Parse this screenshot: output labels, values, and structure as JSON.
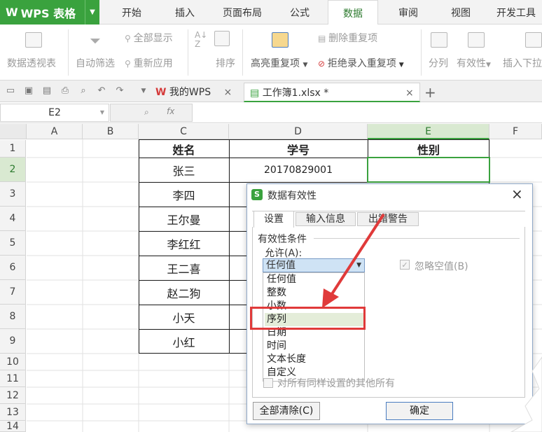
{
  "app": {
    "title": "WPS 表格",
    "logo": "W"
  },
  "menu_tabs": [
    "开始",
    "插入",
    "页面布局",
    "公式",
    "数据",
    "审阅",
    "视图",
    "开发工具"
  ],
  "active_tab": "数据",
  "ribbon": {
    "pivot": "数据透视表",
    "autofilter": "自动筛选",
    "show_all": "全部显示",
    "reapply": "重新应用",
    "sort": "排序",
    "highlight_dup": "高亮重复项",
    "remove_dup": "删除重复项",
    "reject_dup": "拒绝录入重复项",
    "split": "分列",
    "validity": "有效性",
    "insert_dropdown": "插入下拉"
  },
  "doc_tabs": {
    "my_wps": "我的WPS",
    "workbook": "工作簿1.xlsx *"
  },
  "formula_bar": {
    "name_box": "E2",
    "fx": "fx"
  },
  "sheet": {
    "columns": [
      "A",
      "B",
      "C",
      "D",
      "E",
      "F"
    ],
    "rows": [
      "1",
      "2",
      "3",
      "4",
      "5",
      "6",
      "7",
      "8",
      "9",
      "10",
      "11",
      "12",
      "13",
      "14"
    ],
    "header_row": {
      "name": "姓名",
      "id": "学号",
      "gender": "性别"
    },
    "names": [
      "张三",
      "李四",
      "王尔曼",
      "李红红",
      "王二喜",
      "赵二狗",
      "小天",
      "小红"
    ],
    "student_id": "20170829001"
  },
  "dialog": {
    "title": "数据有效性",
    "tabs": [
      "设置",
      "输入信息",
      "出错警告"
    ],
    "section": "有效性条件",
    "allow_label": "允许(A):",
    "allow_value": "任何值",
    "ignore_blank": "忽略空值(B)",
    "options": [
      "任何值",
      "整数",
      "小数",
      "序列",
      "日期",
      "时间",
      "文本长度",
      "自定义"
    ],
    "apply_all": "对所有同样设置的其他所有",
    "clear_all": "全部清除(C)",
    "ok": "确定"
  },
  "colors": {
    "accent": "#3aa23e",
    "highlight": "#e03a3a",
    "selected_option": "#e4edd9"
  }
}
